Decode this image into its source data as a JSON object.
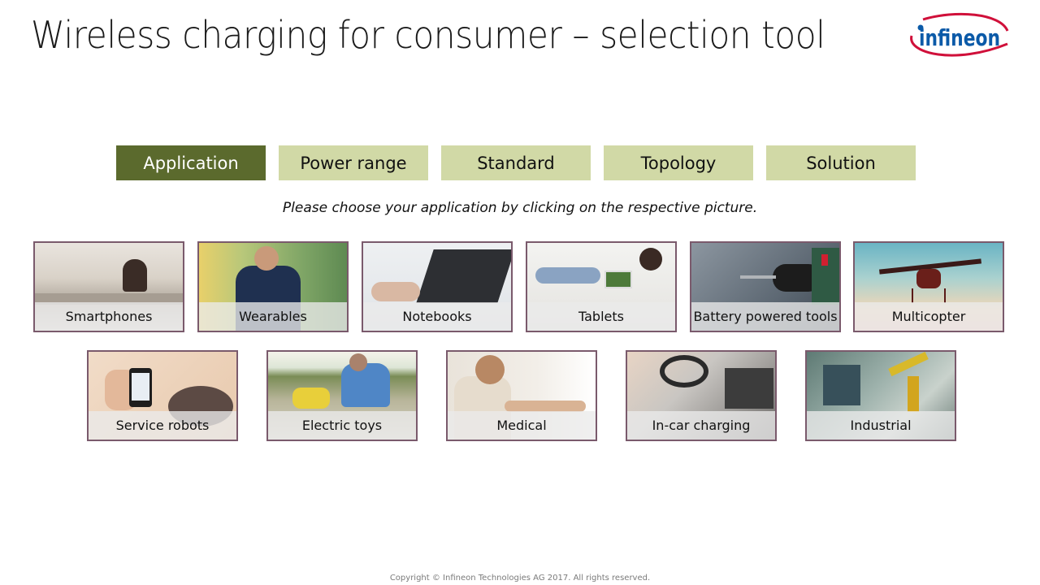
{
  "header": {
    "title": "Wireless charging for consumer – selection tool",
    "logo_text": "infineon"
  },
  "tabs": [
    {
      "label": "Application",
      "active": true
    },
    {
      "label": "Power range",
      "active": false
    },
    {
      "label": "Standard",
      "active": false
    },
    {
      "label": "Topology",
      "active": false
    },
    {
      "label": "Solution",
      "active": false
    }
  ],
  "instruction": "Please choose your application by clicking on the respective picture.",
  "applications": [
    {
      "label": "Smartphones"
    },
    {
      "label": "Wearables"
    },
    {
      "label": "Notebooks"
    },
    {
      "label": "Tablets"
    },
    {
      "label": "Battery powered tools"
    },
    {
      "label": "Multicopter"
    },
    {
      "label": "Service robots"
    },
    {
      "label": "Electric toys"
    },
    {
      "label": "Medical"
    },
    {
      "label": "In-car charging"
    },
    {
      "label": "Industrial"
    }
  ],
  "colors": {
    "tab_active": "#5b6a2d",
    "tab_inactive": "#d1d9a6",
    "tile_border": "#7a5a6c",
    "logo_blue": "#0b5aa8",
    "logo_red": "#d0103a"
  },
  "footer": "Copyright © Infineon Technologies AG 2017. All rights reserved."
}
